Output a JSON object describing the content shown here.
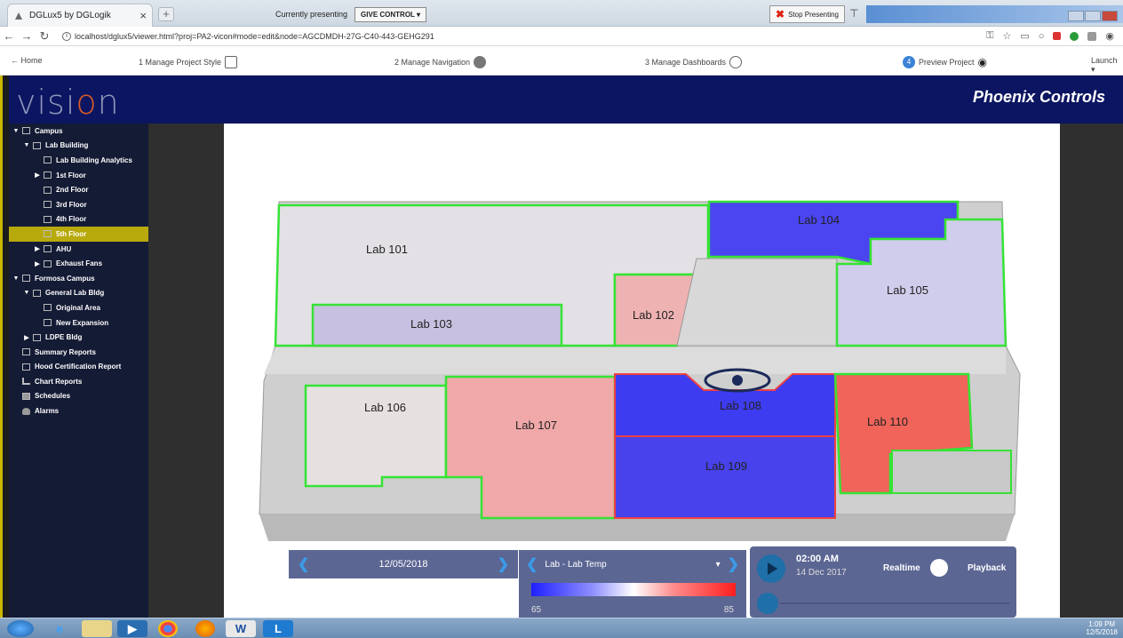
{
  "browser": {
    "tab_title": "DGLux5 by DGLogik",
    "tab_close": "×",
    "new_tab": "+",
    "presenting_text": "Currently presenting",
    "give_control": "GIVE CONTROL ▾",
    "stop_presenting": "Stop Presenting",
    "stop_x": "✖",
    "pin": "⊤",
    "url": "localhost/dglux5/viewer.html?proj=PA2-vicon#mode=edit&node=AGCDMDH-27G-C40-443-GEHG291"
  },
  "steps": {
    "home": "← Home",
    "step1": "1   Manage Project Style",
    "step2": "2   Manage Navigation",
    "step3": "3   Manage Dashboards",
    "step4_num": "4",
    "step4": "Preview Project",
    "launch": "Launch ▾"
  },
  "brand": {
    "logo_v": "visi",
    "logo_o": "o",
    "logo_n": "n",
    "company": "Phoenix Controls"
  },
  "tree": [
    {
      "label": "Campus",
      "depth": 0,
      "caret": "▼"
    },
    {
      "label": "Lab Building",
      "depth": 1,
      "caret": "▼"
    },
    {
      "label": "Lab Building Analytics",
      "depth": 2,
      "caret": ""
    },
    {
      "label": "1st Floor",
      "depth": 2,
      "caret": "▶"
    },
    {
      "label": "2nd Floor",
      "depth": 2,
      "caret": ""
    },
    {
      "label": "3rd Floor",
      "depth": 2,
      "caret": ""
    },
    {
      "label": "4th Floor",
      "depth": 2,
      "caret": ""
    },
    {
      "label": "5th Floor",
      "depth": 2,
      "caret": "",
      "selected": true
    },
    {
      "label": "AHU",
      "depth": 2,
      "caret": "▶"
    },
    {
      "label": "Exhaust Fans",
      "depth": 2,
      "caret": "▶"
    },
    {
      "label": "Formosa Campus",
      "depth": 0,
      "caret": "▼"
    },
    {
      "label": "General Lab Bldg",
      "depth": 1,
      "caret": "▼"
    },
    {
      "label": "Original Area",
      "depth": 2,
      "caret": ""
    },
    {
      "label": "New Expansion",
      "depth": 2,
      "caret": ""
    },
    {
      "label": "LDPE Bldg",
      "depth": 1,
      "caret": "▶"
    },
    {
      "label": "Summary Reports",
      "depth": 0,
      "caret": "",
      "icon": "node"
    },
    {
      "label": "Hood Certification Report",
      "depth": 0,
      "caret": "",
      "icon": "node"
    },
    {
      "label": "Chart Reports",
      "depth": 0,
      "caret": "",
      "icon": "chart"
    },
    {
      "label": "Schedules",
      "depth": 0,
      "caret": "",
      "icon": "cal"
    },
    {
      "label": "Alarms",
      "depth": 0,
      "caret": "",
      "icon": "alarm"
    }
  ],
  "floorplan": {
    "labs": [
      {
        "label": "Lab 101",
        "temp": "neutral"
      },
      {
        "label": "Lab 102",
        "temp": "warm"
      },
      {
        "label": "Lab 103",
        "temp": "cool-light"
      },
      {
        "label": "Lab 104",
        "temp": "cold"
      },
      {
        "label": "Lab 105",
        "temp": "cool-light"
      },
      {
        "label": "Lab 106",
        "temp": "neutral"
      },
      {
        "label": "Lab 107",
        "temp": "warm"
      },
      {
        "label": "Lab 108",
        "temp": "cold"
      },
      {
        "label": "Lab 109",
        "temp": "cold"
      },
      {
        "label": "Lab 110",
        "temp": "hot"
      }
    ],
    "colors": {
      "cold": "#3a3cf0",
      "warm": "#f0a3a3",
      "hot": "#f05a50",
      "outline": "#35e335"
    }
  },
  "controls": {
    "date": "12/05/2018",
    "prev": "❮",
    "next": "❯",
    "metric": "Lab - Lab Temp",
    "metric_caret": "▾",
    "legend_min": "65",
    "legend_max": "85",
    "time": "02:00 AM",
    "time_date": "14 Dec 2017",
    "realtime": "Realtime",
    "playback": "Playback"
  },
  "taskbar": {
    "clock_time": "1:09 PM",
    "clock_date": "12/5/2018"
  }
}
